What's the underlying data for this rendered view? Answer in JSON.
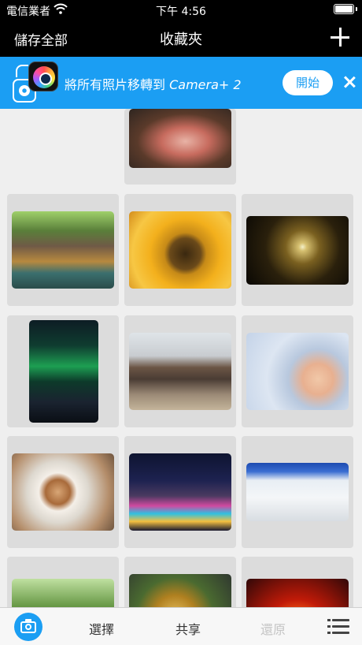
{
  "status": {
    "carrier": "電信業者",
    "time": "下午 4:56"
  },
  "nav": {
    "left_label": "儲存全部",
    "title": "收藏夾",
    "add_icon": "plus-icon"
  },
  "banner": {
    "text_prefix": "將所有照片移轉到 ",
    "text_brand": "Camera+ 2",
    "start_label": "開始",
    "close_icon": "close-icon",
    "accent": "#1b9ef3"
  },
  "photos": [
    "bbq-grill",
    "floating-market",
    "sunflower",
    "spiral-light",
    "aurora",
    "elephant-ride",
    "baby-reaching",
    "latte-art",
    "windmill-lights",
    "ski-slope",
    "forest",
    "dragon-statue",
    "light-tunnel"
  ],
  "tabbar": {
    "camera_icon": "camera-icon",
    "select_label": "選擇",
    "share_label": "共享",
    "restore_label": "還原",
    "list_icon": "list-icon"
  }
}
